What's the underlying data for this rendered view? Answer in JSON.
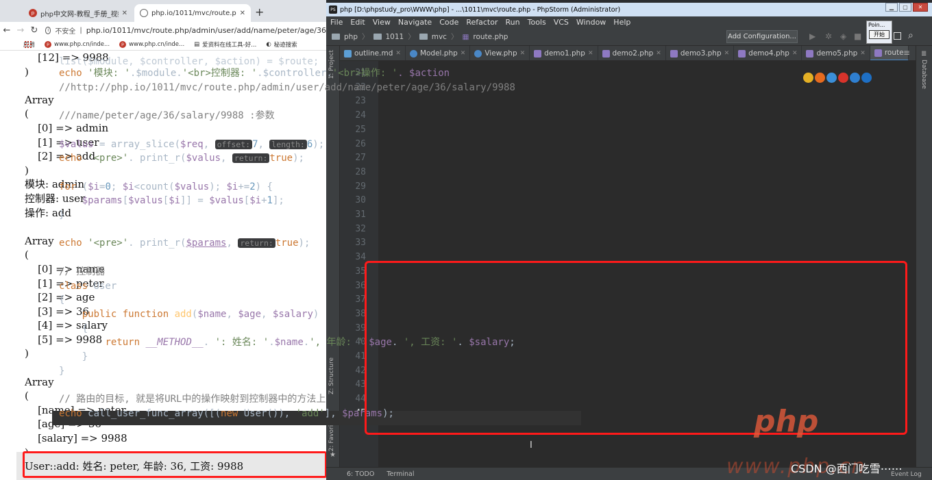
{
  "browser": {
    "tabs": [
      {
        "label": "php中文网-教程_手册_视频-免"
      },
      {
        "label": "php.io/1011/mvc/route.php/a"
      }
    ],
    "new_tab": "+",
    "address": {
      "security": "不安全",
      "separator": "|",
      "url": "php.io/1011/mvc/route.php/admin/user/add/name/peter/age/36"
    },
    "bookmarks": [
      {
        "label": "应用"
      },
      {
        "label": "www.php.cn/inde..."
      },
      {
        "label": "www.php.cn/inde..."
      },
      {
        "label": "爱资料在线工具-好..."
      },
      {
        "label": "秘迹搜索"
      }
    ],
    "output_lines": [
      "    [12] => 9988",
      ")",
      "",
      "Array",
      "(",
      "    [0] => admin",
      "    [1] => user",
      "    [2] => add",
      ")",
      "模块: admin",
      "控制器: user",
      "操作: add",
      "",
      "Array",
      "(",
      "    [0] => name",
      "    [1] => peter",
      "    [2] => age",
      "    [3] => 36",
      "    [4] => salary",
      "    [5] => 9988",
      ")",
      "",
      "Array",
      "(",
      "    [name] => peter",
      "    [age] => 36",
      "    [salary] => 9988",
      ")"
    ],
    "result_line": "User::add: 姓名: peter, 年龄: 36, 工资: 9988"
  },
  "ide": {
    "title": "php [D:\\phpstudy_pro\\WWW\\php] - ...\\1011\\mvc\\route.php - PhpStorm (Administrator)",
    "menu": [
      "File",
      "Edit",
      "View",
      "Navigate",
      "Code",
      "Refactor",
      "Run",
      "Tools",
      "VCS",
      "Window",
      "Help"
    ],
    "breadcrumb": [
      "php",
      "1011",
      "mvc",
      "route.php"
    ],
    "add_configuration": "Add Configuration...",
    "popup": {
      "title": "Poin...",
      "button": "开始"
    },
    "tabs": [
      "outline.md",
      "Model.php",
      "View.php",
      "demo1.php",
      "demo2.php",
      "demo3.php",
      "demo4.php",
      "demo5.php",
      "route"
    ],
    "side_labels": {
      "project": "1: Project",
      "structure": "Z: Structure",
      "favorites": "2: Favorites",
      "database": "Database"
    },
    "line_numbers": [
      "21",
      "22",
      "23",
      "24",
      "25",
      "26",
      "27",
      "28",
      "29",
      "30",
      "31",
      "32",
      "33",
      "34",
      "35",
      "36",
      "37",
      "38",
      "39",
      "40",
      "41",
      "42",
      "43",
      "44",
      "45"
    ],
    "code": {
      "l20": "list($module, $controller, $action) = $route;",
      "l21_a": "echo ",
      "l21_b": "'模块: '",
      "l21_c": ".$module.",
      "l21_d": "'<br>控制器: '",
      "l21_e": ".$controller.",
      "l21_f": "'<br>操作: '",
      "l21_g": ". $action",
      "l22": "//http://php.io/1011/mvc/route.php/admin/user/add/name/peter/age/36/salary/9988",
      "l24": "///name/peter/age/36/salary/9988 :参数",
      "l26_a": "$valus",
      "l26_b": " = array_slice(",
      "l26_c": "$req",
      "l26_d": ", ",
      "l26_h1": "offset:",
      "l26_e": "7",
      "l26_f": ", ",
      "l26_h2": "length:",
      "l26_g": "6",
      "l26_i": ");",
      "l27_a": "echo ",
      "l27_b": "'<pre>'",
      "l27_c": ". print_r(",
      "l27_d": "$valus",
      "l27_e": ", ",
      "l27_h": "return:",
      "l27_f": "true",
      "l27_g": ");",
      "l29_a": "for ",
      "l29_b": "(",
      "l29_c": "$i",
      "l29_d": "=",
      "l29_e": "0",
      "l29_f": "; ",
      "l29_g": "$i",
      "l29_h": "<count(",
      "l29_i": "$valus",
      "l29_j": "); ",
      "l29_k": "$i",
      "l29_l": "+=",
      "l29_m": "2",
      "l29_n": ") {",
      "l30_a": "$params",
      "l30_b": "[",
      "l30_c": "$valus",
      "l30_d": "[",
      "l30_e": "$i",
      "l30_f": "]] = ",
      "l30_g": "$valus",
      "l30_h": "[",
      "l30_i": "$i",
      "l30_j": "+",
      "l30_k": "1",
      "l30_l": "];",
      "l31": "}",
      "l33_a": "echo ",
      "l33_b": "'<pre>'",
      "l33_c": ". print_r(",
      "l33_d": "$params",
      "l33_e": ", ",
      "l33_h": "return:",
      "l33_f": "true",
      "l33_g": ");",
      "l35": "// 控制器",
      "l36_a": "class ",
      "l36_b": "User",
      "l37": "{",
      "l38_a": "public function ",
      "l38_b": "add",
      "l38_c": "(",
      "l38_d": "$name",
      "l38_e": ", ",
      "l38_f": "$age",
      "l38_g": ", ",
      "l38_h": "$salary",
      "l38_i": ")",
      "l39": "{",
      "l40_a": "return ",
      "l40_b": "__METHOD__",
      "l40_c": ". ",
      "l40_d": "': 姓名: '",
      "l40_e": ".",
      "l40_f": "$name",
      "l40_g": ".",
      "l40_h": "', 年龄: '",
      "l40_i": ".",
      "l40_j": "$age",
      "l40_k": ". ",
      "l40_l": "', 工资: '",
      "l40_m": ". ",
      "l40_n": "$salary",
      "l40_o": ";",
      "l41": "}",
      "l42": "}",
      "l44": "// 路由的目标, 就是将URL中的操作映射到控制器中的方法上",
      "l45_a": "echo ",
      "l45_b": "call_user_func_array",
      "l45_c": "([(",
      "l45_d": "new ",
      "l45_e": "User",
      "l45_f": "()), ",
      "l45_g": "'add'",
      "l45_h": "], ",
      "l45_i": "$params",
      "l45_j": ");"
    },
    "bottom": [
      "6: TODO",
      "Terminal"
    ],
    "event_log": "Event Log"
  },
  "watermark": {
    "logo": "php",
    "site": "www.php.cn",
    "credit": "CSDN @西门吃雪⋯⋯"
  },
  "colors": {
    "highlight_box": "#ff1a1a",
    "editor_bg": "#2b2b2b",
    "keyword": "#cc7832",
    "variable": "#9876aa",
    "string": "#6a8759"
  }
}
